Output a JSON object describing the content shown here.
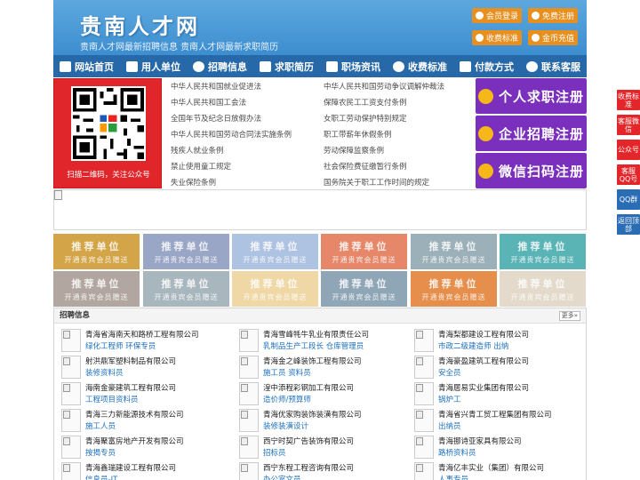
{
  "header": {
    "site_title": "贵南人才网",
    "subtitle": "贵南人才网最新招聘信息   贵南人才网最新求职简历",
    "buttons": [
      "会员登录",
      "免费注册",
      "收费标准",
      "金币充值"
    ]
  },
  "nav": [
    "网站首页",
    "用人单位",
    "招聘信息",
    "求职简历",
    "职场资讯",
    "收费标准",
    "付款方式",
    "联系客服"
  ],
  "qr": {
    "caption": "扫描二维码，关注公众号"
  },
  "laws": [
    [
      "中华人民共和国就业促进法",
      "中华人民共和国劳动争议调解仲裁法"
    ],
    [
      "中华人民共和国工会法",
      "保障农民工工资支付条例"
    ],
    [
      "全国年节及纪念日放假办法",
      "女职工劳动保护特别规定"
    ],
    [
      "中华人民共和国劳动合同法实施条例",
      "职工带薪年休假条例"
    ],
    [
      "残疾人就业条例",
      "劳动保障监察条例"
    ],
    [
      "禁止使用童工规定",
      "社会保险费征缴暂行条例"
    ],
    [
      "失业保险条例",
      "国务院关于职工工作时间的规定"
    ]
  ],
  "register": [
    "个人求职注册",
    "企业招聘注册",
    "微信扫码注册"
  ],
  "recommend": {
    "title": "推荐单位",
    "subtitle": "开通贵宾会员赠送",
    "colors": [
      "#d4a548",
      "#9aa6c6",
      "#aec3e2",
      "#e6876a",
      "#9bb0b8",
      "#5ab3b5",
      "#b2a7a0",
      "#a8b7be",
      "#efd8a6",
      "#8fa6b6",
      "#e68e4c",
      "#e3dacb"
    ]
  },
  "jobs": {
    "title": "招聘信息",
    "more": "更多»",
    "items": [
      {
        "company": "青海省海南天和路桥工程有限公司",
        "position": "绿化工程师  环保专员"
      },
      {
        "company": "青海雪峰牦牛乳业有限责任公司",
        "position": "乳制品生产工段长  仓库管理员"
      },
      {
        "company": "青海梨都建设工程有限公司",
        "position": "市政二级建造师  出纳"
      },
      {
        "company": "射洪鼎军塑料制品有限公司",
        "position": "装修资料员"
      },
      {
        "company": "青海金之峰装饰工程有限公司",
        "position": "施工员  资料员"
      },
      {
        "company": "青海豪盈建筑工程有限公司",
        "position": "安全员"
      },
      {
        "company": "海南金豪建筑工程有限公司",
        "position": "工程项目资料员"
      },
      {
        "company": "湟中添程彩钢加工有限公司",
        "position": "造价师/预算师"
      },
      {
        "company": "青海居易实业集团有限公司",
        "position": "锅炉工"
      },
      {
        "company": "青海三力新能源技术有限公司",
        "position": "施工人员"
      },
      {
        "company": "青海优家购装饰装潢有限公司",
        "position": "装修装潢设计"
      },
      {
        "company": "青海省兴青工贸工程集团有限公司",
        "position": "出纳员"
      },
      {
        "company": "青海聚富房地产开发有限公司",
        "position": "按揭专员"
      },
      {
        "company": "西宁时契广告装饰有限公司",
        "position": "招标员"
      },
      {
        "company": "青海挪诗亚家具有限公司",
        "position": "路桥资料员"
      },
      {
        "company": "青海鑫瑞建设工程有限公司",
        "position": "信息员-IT"
      },
      {
        "company": "西宁东程工程咨询有限公司",
        "position": "办公室文员"
      },
      {
        "company": "青海亿丰实业（集团）有限公司",
        "position": "人事专员"
      }
    ]
  },
  "sidebar": [
    "收费标准",
    "客服微信",
    "公众号",
    "客服QQ号",
    "QQ群",
    "返回顶部"
  ]
}
